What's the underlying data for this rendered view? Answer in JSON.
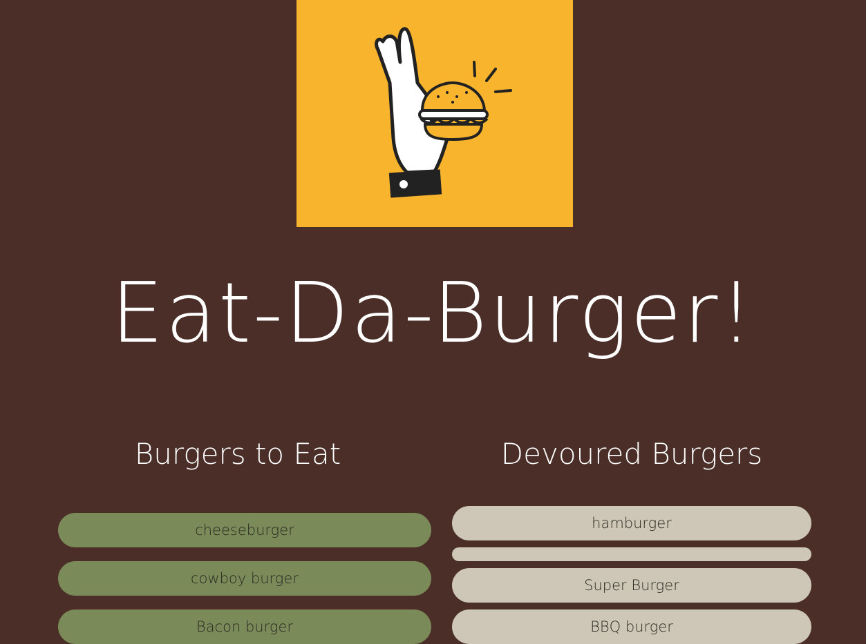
{
  "brand": {
    "logo_icon": "ok-hand-holding-burger-icon",
    "logo_background": "#f8b42c"
  },
  "header": {
    "title": "Eat-Da-Burger!"
  },
  "columns": {
    "to_eat": {
      "heading": "Burgers to Eat",
      "items": [
        {
          "label": "cheeseburger"
        },
        {
          "label": "cowboy burger"
        },
        {
          "label": "Bacon burger"
        }
      ]
    },
    "devoured": {
      "heading": "Devoured Burgers",
      "items": [
        {
          "label": "hamburger"
        },
        {
          "label": ""
        },
        {
          "label": "Super Burger"
        },
        {
          "label": "BBQ burger"
        }
      ]
    }
  },
  "colors": {
    "page_background": "#4a2e27",
    "to_eat_pill": "#7a8a58",
    "devoured_pill": "#cec6b6",
    "text_light": "#ffffff"
  }
}
